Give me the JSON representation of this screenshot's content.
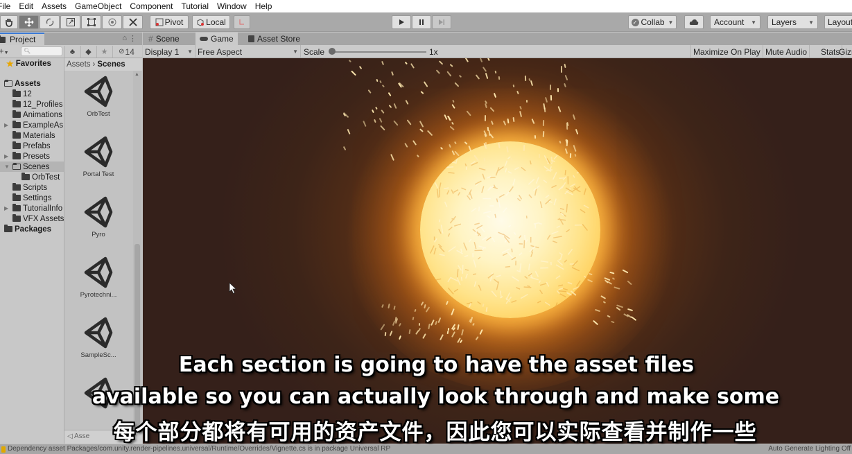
{
  "menu": [
    "File",
    "Edit",
    "Assets",
    "GameObject",
    "Component",
    "Tutorial",
    "Window",
    "Help"
  ],
  "toolbar": {
    "tools": [
      "hand-tool",
      "move-tool",
      "rotate-tool",
      "scale-tool",
      "rect-tool",
      "transform-tool",
      "custom-tool"
    ],
    "active_tool": "move-tool",
    "pivot_label": "Pivot",
    "local_label": "Local",
    "collab_label": "Collab",
    "account_label": "Account",
    "layers_label": "Layers",
    "layout_label": "Layout"
  },
  "project": {
    "tab_label": "Project",
    "hidden_count": "14",
    "search_placeholder": "",
    "tree": [
      {
        "label": "Favorites",
        "type": "favorites",
        "bold": true
      },
      {
        "label": "Assets",
        "type": "open-folder",
        "bold": true
      },
      {
        "label": "12",
        "type": "folder"
      },
      {
        "label": "12_Profiles",
        "type": "folder"
      },
      {
        "label": "Animations",
        "type": "folder"
      },
      {
        "label": "ExampleAs",
        "type": "folder",
        "expandable": true
      },
      {
        "label": "Materials",
        "type": "folder"
      },
      {
        "label": "Prefabs",
        "type": "folder"
      },
      {
        "label": "Presets",
        "type": "folder",
        "expandable": true
      },
      {
        "label": "Scenes",
        "type": "open-folder",
        "expanded": true,
        "selected": true
      },
      {
        "label": "OrbTest",
        "type": "folder",
        "child": true
      },
      {
        "label": "Scripts",
        "type": "folder"
      },
      {
        "label": "Settings",
        "type": "folder"
      },
      {
        "label": "TutorialInfo",
        "type": "folder",
        "expandable": true
      },
      {
        "label": "VFX Assets",
        "type": "folder"
      },
      {
        "label": "Packages",
        "type": "folder",
        "bold": true
      }
    ],
    "breadcrumb": [
      "Assets",
      "Scenes"
    ],
    "assets": [
      "OrbTest",
      "Portal Test",
      "Pyro",
      "Pyrotechni...",
      "SampleSc...",
      ""
    ],
    "bottom_label": "Asse"
  },
  "game": {
    "tabs": [
      {
        "label": "Scene",
        "icon": "grid-icon"
      },
      {
        "label": "Game",
        "icon": "gamepad-icon",
        "active": true
      },
      {
        "label": "Asset Store",
        "icon": "bag-icon"
      }
    ],
    "display": "Display 1",
    "aspect": "Free Aspect",
    "scale_label": "Scale",
    "scale_value": "1x",
    "scale_fraction": 0.0,
    "maximize_label": "Maximize On Play",
    "mute_label": "Mute Audio",
    "stats_label": "Stats",
    "gizmos_label": "Gizmos"
  },
  "subtitles": {
    "line1": "Each section is going to have the asset files",
    "line2": "available so you can actually look through and make some",
    "line3": "每个部分都将有可用的资产文件，因此您可以实际查看并制作一些"
  },
  "status": {
    "message": "Dependency asset Packages/com.unity.render-pipelines.universal/Runtime/Overrides/Vignette.cs is in package Universal RP",
    "right": "Auto Generate Lighting Off"
  },
  "colors": {
    "accent": "#3a79d6",
    "warning": "#e0a800",
    "orb": "#ffe38a"
  }
}
